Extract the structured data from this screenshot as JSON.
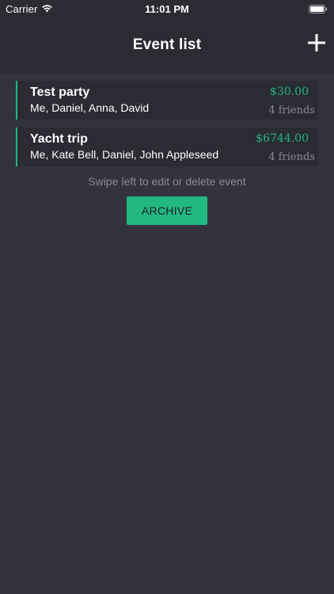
{
  "status_bar": {
    "carrier": "Carrier",
    "time": "11:01 PM"
  },
  "nav": {
    "title": "Event list",
    "add_icon": "plus-icon"
  },
  "events": [
    {
      "title": "Test party",
      "members": "Me, Daniel, Anna, David",
      "amount": "$30.00",
      "friends": "4 friends"
    },
    {
      "title": "Yacht trip",
      "members": "Me, Kate Bell, Daniel, John Appleseed",
      "amount": "$6744.00",
      "friends": "4 friends"
    }
  ],
  "hint": "Swipe left to edit or delete event",
  "archive_label": "ARCHIVE",
  "colors": {
    "background": "#32333d",
    "header_background": "#2a2b33",
    "accent": "#21b882",
    "muted_text": "#8a8b93"
  }
}
